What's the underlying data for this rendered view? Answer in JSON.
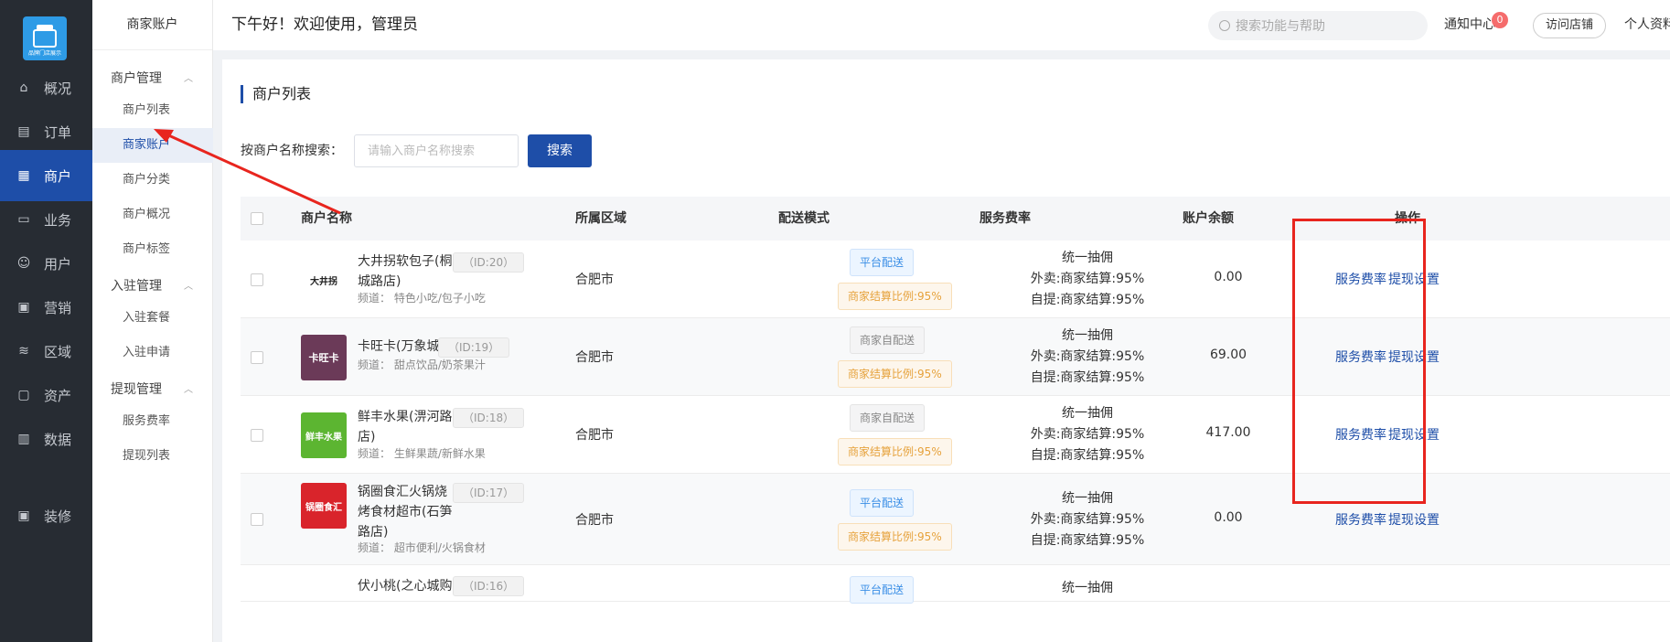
{
  "logo": {
    "caption": "品牌门店展示"
  },
  "nav": [
    {
      "label": "概况",
      "icon": "presentation-icon",
      "active": false
    },
    {
      "label": "订单",
      "icon": "order-list-icon",
      "active": false
    },
    {
      "label": "商户",
      "icon": "building-icon",
      "active": true
    },
    {
      "label": "业务",
      "icon": "monitor-icon",
      "active": false
    },
    {
      "label": "用户",
      "icon": "user-icon",
      "active": false
    },
    {
      "label": "营销",
      "icon": "lock-icon",
      "active": false
    },
    {
      "label": "区域",
      "icon": "database-icon",
      "active": false
    },
    {
      "label": "资产",
      "icon": "wallet-icon",
      "active": false
    },
    {
      "label": "数据",
      "icon": "bar-chart-icon",
      "active": false
    },
    {
      "label": "装修",
      "icon": "lock-icon",
      "active": false
    }
  ],
  "subnav": {
    "title": "商家账户",
    "groups": [
      {
        "label": "商户管理",
        "items": [
          "商户列表",
          "商家账户",
          "商户分类",
          "商户概况",
          "商户标签"
        ]
      },
      {
        "label": "入驻管理",
        "items": [
          "入驻套餐",
          "入驻申请"
        ]
      },
      {
        "label": "提现管理",
        "items": [
          "服务费率",
          "提现列表"
        ]
      }
    ],
    "active_item": "商家账户"
  },
  "header": {
    "greeting": "下午好！欢迎使用，管理员",
    "search_placeholder": "搜索功能与帮助",
    "notify": "通知中心",
    "notify_count": "0",
    "visit_store": "访问店铺",
    "profile": "个人资料"
  },
  "page": {
    "title": "商户列表",
    "search_label": "按商户名称搜索：",
    "search_placeholder": "请输入商户名称搜索",
    "search_button": "搜索"
  },
  "table": {
    "columns": [
      "商户名称",
      "所属区域",
      "配送模式",
      "服务费率",
      "账户余额",
      "操作"
    ],
    "rows": [
      {
        "logo_text": "大井拐",
        "logo_color": "#ffffff",
        "logo_fg": "#222222",
        "name": "大井拐软包子(桐城路店)",
        "id": "（ID:20）",
        "channel": "频道： 特色小吃/包子小吃",
        "region": "合肥市",
        "delivery": "平台配送",
        "delivery_type": "platform",
        "ratio": "商家结算比例:95%",
        "rate_lines": [
          "统一抽佣",
          "外卖:商家结算:95%",
          "自提:商家结算:95%"
        ],
        "balance": "0.00",
        "ops": [
          "服务费率",
          "提现设置"
        ]
      },
      {
        "logo_text": "卡旺卡",
        "logo_color": "#6b3a58",
        "logo_fg": "#ffffff",
        "name": "卡旺卡(万象城店)",
        "id": "（ID:19）",
        "channel": "频道： 甜点饮品/奶茶果汁",
        "region": "合肥市",
        "delivery": "商家自配送",
        "delivery_type": "self",
        "ratio": "商家结算比例:95%",
        "rate_lines": [
          "统一抽佣",
          "外卖:商家结算:95%",
          "自提:商家结算:95%"
        ],
        "balance": "69.00",
        "ops": [
          "服务费率",
          "提现设置"
        ]
      },
      {
        "logo_text": "鲜丰水果",
        "logo_color": "#5cb531",
        "logo_fg": "#ffffff",
        "name": "鲜丰水果(淠河路店)",
        "id": "（ID:18）",
        "channel": "频道： 生鲜果蔬/新鲜水果",
        "region": "合肥市",
        "delivery": "商家自配送",
        "delivery_type": "self",
        "ratio": "商家结算比例:95%",
        "rate_lines": [
          "统一抽佣",
          "外卖:商家结算:95%",
          "自提:商家结算:95%"
        ],
        "balance": "417.00",
        "ops": [
          "服务费率",
          "提现设置"
        ]
      },
      {
        "logo_text": "锅圈食汇",
        "logo_color": "#d9242b",
        "logo_fg": "#ffffff",
        "name": "锅圈食汇火锅烧烤食材超市(石笋路店)",
        "id": "（ID:17）",
        "channel": "频道： 超市便利/火锅食材",
        "region": "合肥市",
        "delivery": "平台配送",
        "delivery_type": "platform",
        "ratio": "商家结算比例:95%",
        "rate_lines": [
          "统一抽佣",
          "外卖:商家结算:95%",
          "自提:商家结算:95%"
        ],
        "balance": "0.00",
        "ops": [
          "服务费率",
          "提现设置"
        ]
      }
    ],
    "partial_row": {
      "name": "伏小桃(之心城购",
      "id": "（ID:16）",
      "delivery": "平台配送",
      "rate": "统一抽佣"
    }
  }
}
